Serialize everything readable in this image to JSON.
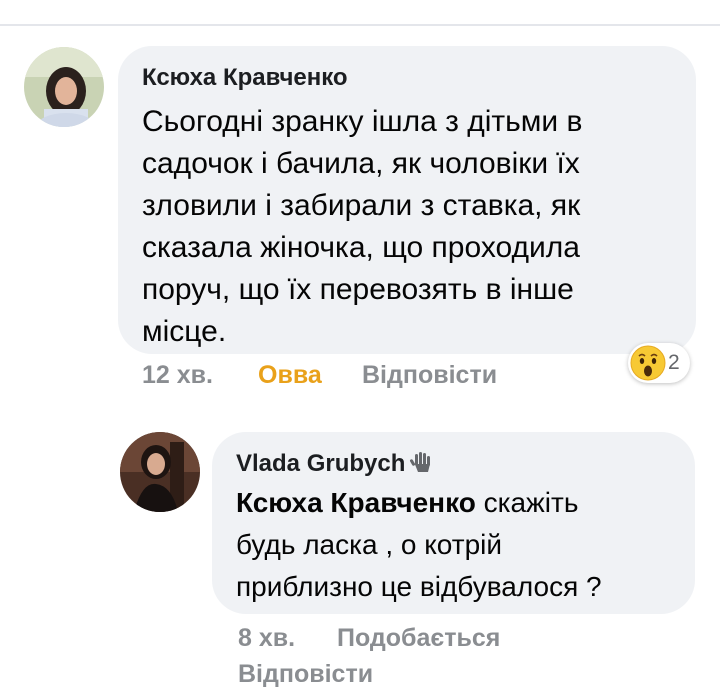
{
  "comment": {
    "author": "Ксюха Кравченко",
    "text_lines": [
      "Сьогодні зранку ішла з дітьми в",
      "садочок і бачила, як чоловіки їх",
      "зловили і забирали з ставка, як",
      "сказала жіночка, що проходила",
      "поруч, що їх перевозять в інше",
      "місце."
    ],
    "time": "12 хв.",
    "reaction_label": "Овва",
    "reply_label": "Відповісти",
    "reaction_icon": "wow-emoji-icon",
    "reaction_count": "2"
  },
  "reply": {
    "author": "Vlada Grubych",
    "badge_icon": "hand-wave-icon",
    "mention": "Ксюха Кравченко",
    "text_first_rest": " скажіть",
    "text_lines": [
      "будь ласка , о котрій",
      "приблизно це відбувалося ?"
    ],
    "time": "8 хв.",
    "like_label": "Подобається",
    "reply_label": "Відповісти"
  },
  "colors": {
    "bubble": "#f0f2f5",
    "meta": "#8a8d91",
    "reaction": "#e9a11a"
  }
}
